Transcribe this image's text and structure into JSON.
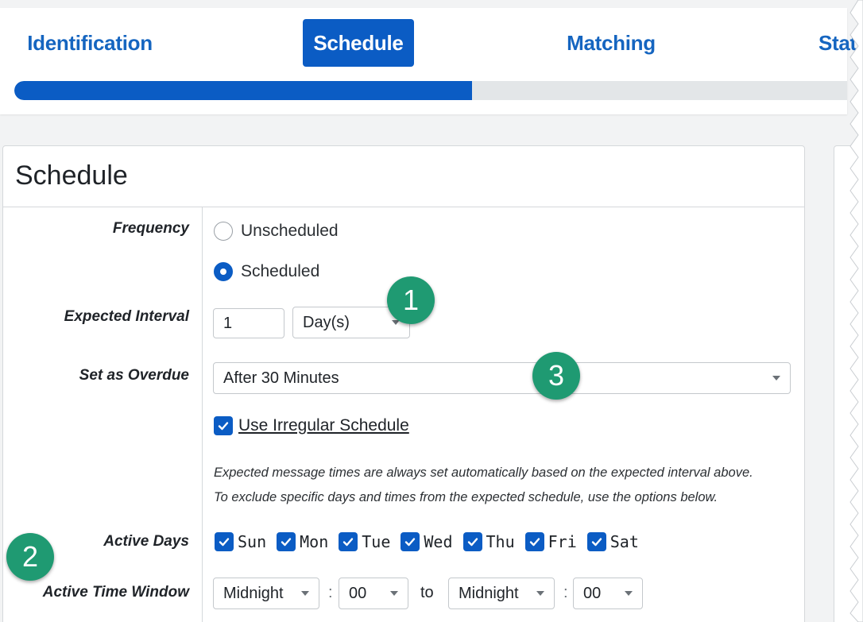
{
  "wizard": {
    "tabs": [
      {
        "label": "Identification",
        "active": false
      },
      {
        "label": "Schedule",
        "active": true
      },
      {
        "label": "Matching",
        "active": false
      },
      {
        "label": "Stat",
        "active": false
      }
    ],
    "progress_fraction": 0.55
  },
  "panel": {
    "title": "Schedule",
    "frequency": {
      "label": "Frequency",
      "options": [
        "Unscheduled",
        "Scheduled"
      ],
      "selected": "Scheduled"
    },
    "expected_interval": {
      "label": "Expected Interval",
      "value": "1",
      "unit": "Day(s)"
    },
    "overdue": {
      "label": "Set as Overdue",
      "value": "After 30 Minutes"
    },
    "irregular": {
      "label": "Use Irregular Schedule",
      "checked": true
    },
    "help": {
      "line1": "Expected message times are always set automatically based on the expected interval above.",
      "line2": "To exclude specific days and times from the expected schedule, use the options below."
    },
    "active_days": {
      "label": "Active Days",
      "days": [
        "Sun",
        "Mon",
        "Tue",
        "Wed",
        "Thu",
        "Fri",
        "Sat"
      ]
    },
    "time_window": {
      "label": "Active Time Window",
      "from_hour": "Midnight",
      "from_minute": "00",
      "to_label": "to",
      "to_hour": "Midnight",
      "to_minute": "00",
      "separator": ":"
    }
  },
  "callouts": {
    "one": "1",
    "two": "2",
    "three": "3"
  },
  "colors": {
    "primary": "#0b5cc4",
    "callout": "#1f9a72"
  }
}
